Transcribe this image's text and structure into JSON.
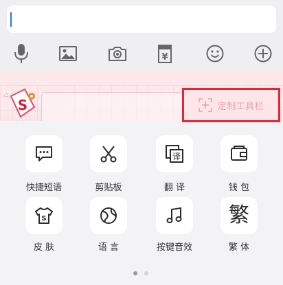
{
  "input": {
    "value": ""
  },
  "toolbar": {
    "icons": [
      "microphone-icon",
      "image-icon",
      "camera-icon",
      "clipboard-yen-icon",
      "emoji-icon",
      "add-icon"
    ]
  },
  "banner": {
    "logo_glyph": "S",
    "customize_label": "定制工具栏",
    "accent_color": "#e3262f"
  },
  "features": [
    {
      "label": "快捷短语",
      "icon": "quick-phrase-icon"
    },
    {
      "label": "剪贴板",
      "icon": "scissors-icon"
    },
    {
      "label": "翻 译",
      "icon": "translate-icon",
      "icon_text": "译"
    },
    {
      "label": "钱 包",
      "icon": "wallet-icon"
    },
    {
      "label": "皮 肤",
      "icon": "skin-tshirt-icon",
      "icon_text": "S"
    },
    {
      "label": "语 言",
      "icon": "globe-icon"
    },
    {
      "label": "按键音效",
      "icon": "music-note-icon"
    },
    {
      "label": "繁 体",
      "icon": "traditional-chinese-icon",
      "icon_text": "繁"
    }
  ],
  "pagination": {
    "pages": 2,
    "current": 1
  }
}
